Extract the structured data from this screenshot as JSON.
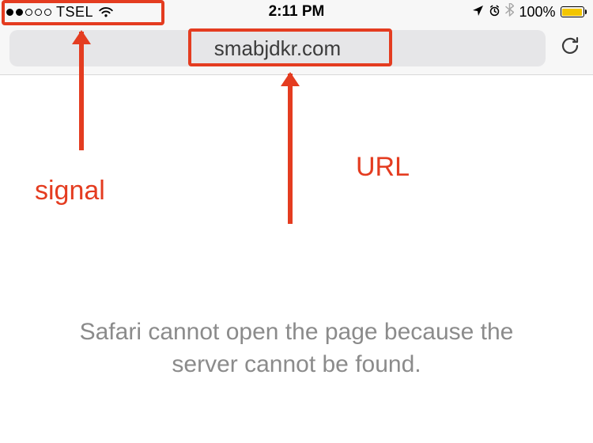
{
  "status_bar": {
    "carrier": "TSEL",
    "time": "2:11 PM",
    "battery_percent": "100%"
  },
  "url_bar": {
    "url": "smabjdkr.com"
  },
  "error": {
    "message": "Safari cannot open the page because the server cannot be found."
  },
  "annotations": {
    "signal_label": "signal",
    "url_label": "URL"
  },
  "colors": {
    "annotation_red": "#e43c20",
    "battery_yellow": "#f2c500"
  }
}
